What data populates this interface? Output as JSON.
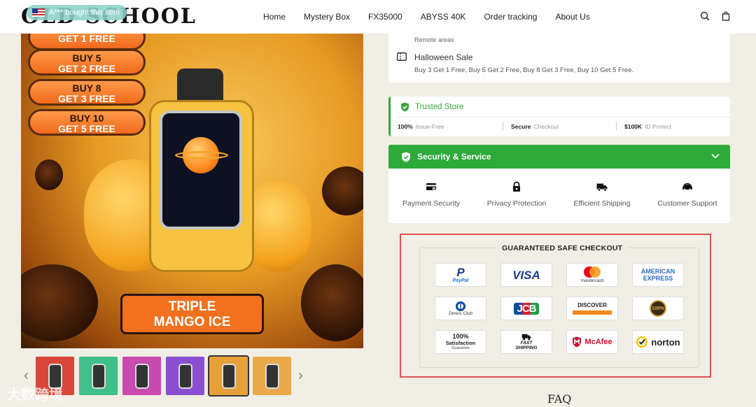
{
  "header": {
    "logo": "OLD SCHOOL",
    "notification": "A*** bought this item",
    "nav": [
      "Home",
      "Mystery Box",
      "FX35000",
      "ABYSS 40K",
      "Order tracking",
      "About Us"
    ],
    "icons": [
      "search-icon",
      "bag-icon"
    ]
  },
  "product_image": {
    "promos": [
      {
        "l1": "GET 1 FREE",
        "l2": ""
      },
      {
        "l1": "BUY 5",
        "l2": "GET 2 FREE"
      },
      {
        "l1": "BUY 8",
        "l2": "GET 3 FREE"
      },
      {
        "l1": "BUY 10",
        "l2": "GET 5 FREE"
      }
    ],
    "flavor_l1": "TRIPLE",
    "flavor_l2": "MANGO ICE"
  },
  "thumbnails": {
    "colors": [
      "#d8473a",
      "#3fbf8a",
      "#c84bb0",
      "#8a4fd0",
      "#e7a13a",
      "#e9a94a"
    ],
    "prev": "‹",
    "next": "›"
  },
  "shipping": {
    "sub": "Remote areas"
  },
  "sale": {
    "title": "Halloween Sale",
    "desc": "Buy 3 Get 1 Free, Buy 5 Get 2 Free, Buy 8 Get 3 Free, Buy 10 Get 5 Free."
  },
  "trusted": {
    "title": "Trusted Store",
    "metrics": [
      {
        "value": "100%",
        "label": "Issue-Free"
      },
      {
        "value": "Secure",
        "label": "Checkout"
      },
      {
        "value": "$100K",
        "label": "ID Protect"
      }
    ]
  },
  "security": {
    "title": "Security & Service",
    "services": [
      {
        "label": "Payment Security",
        "icon": "card-icon"
      },
      {
        "label": "Privacy Protection",
        "icon": "lock-icon"
      },
      {
        "label": "Efficient Shipping",
        "icon": "truck-icon"
      },
      {
        "label": "Customer Support",
        "icon": "headset-icon"
      }
    ]
  },
  "checkout": {
    "title": "GUARANTEED SAFE CHECKOUT",
    "badges": {
      "paypal": {
        "main": "P",
        "sub": "PayPal"
      },
      "visa": "VISA",
      "mastercard": "mastercard",
      "amex_l1": "AMERICAN",
      "amex_l2": "EXPRESS",
      "diners": "Diners Club",
      "jcb": "JCB",
      "discover": "DISCOVER",
      "seal": "100%",
      "satisfaction": {
        "l1": "100%",
        "l2": "Satisfaction",
        "l3": "Guarantee"
      },
      "fast_shipping": {
        "l1": "FAST",
        "l2": "SHIPPING"
      },
      "mcafee": "McAfee",
      "norton": "norton"
    }
  },
  "faq": "FAQ",
  "watermark": "大数跨境"
}
